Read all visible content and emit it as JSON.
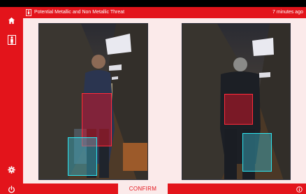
{
  "header": {
    "title": "Potential Metallic and Non Metallic Threat",
    "time_ago": "7 minutes ago"
  },
  "sidebar": {
    "items": [
      {
        "icon": "home-icon"
      },
      {
        "icon": "person-scan-icon"
      },
      {
        "icon": "gear-icon"
      },
      {
        "icon": "power-icon"
      }
    ]
  },
  "footer": {
    "confirm_label": "CONFIRM",
    "info_icon": "info-icon"
  },
  "scans": [
    {
      "view": "front",
      "detections": [
        "metallic",
        "non-metallic"
      ]
    },
    {
      "view": "back",
      "detections": [
        "metallic",
        "non-metallic"
      ]
    }
  ],
  "colors": {
    "brand_red": "#e3141b",
    "metallic": "#ff2b3a",
    "non_metallic": "#2ee6f0",
    "content_bg": "#fbeaea"
  }
}
